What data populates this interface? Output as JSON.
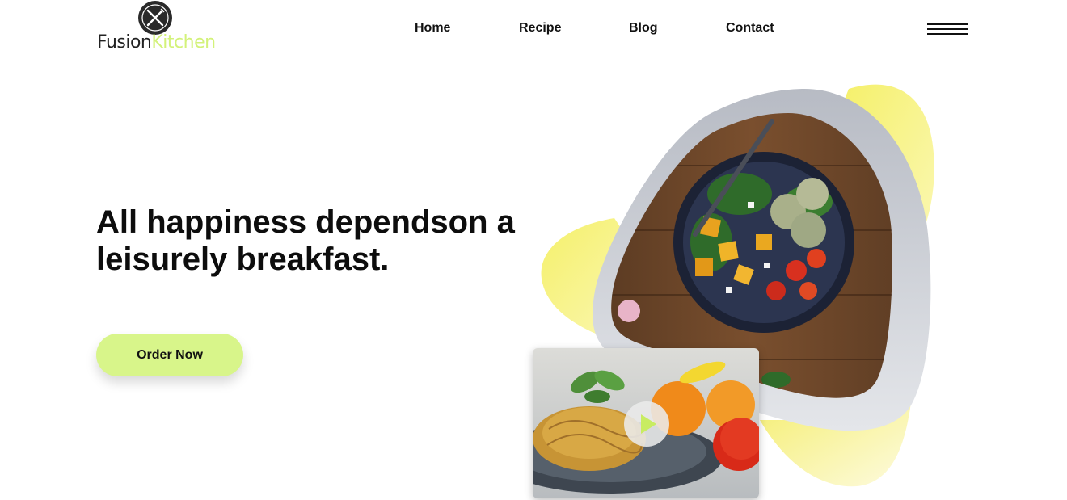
{
  "brand": {
    "name_part1": "Fusion",
    "name_part2": "Kitchen",
    "logo_icon": "fork-knife-icon",
    "accent_color": "#d3f27a"
  },
  "nav": {
    "items": [
      {
        "label": "Home"
      },
      {
        "label": "Recipe"
      },
      {
        "label": "Blog"
      },
      {
        "label": "Contact"
      }
    ],
    "menu_icon": "hamburger-menu-icon"
  },
  "hero": {
    "title": "All happiness dependson a leisurely breakfast.",
    "cta_label": "Order Now",
    "cta_color": "#d8f58a"
  },
  "media": {
    "featured_image": "salad-bowl-image",
    "video_thumbnail": "pasta-plate-image",
    "play_icon": "play-icon",
    "blob_color": "#f7f27a",
    "frame_color": "#bcc0c8"
  }
}
